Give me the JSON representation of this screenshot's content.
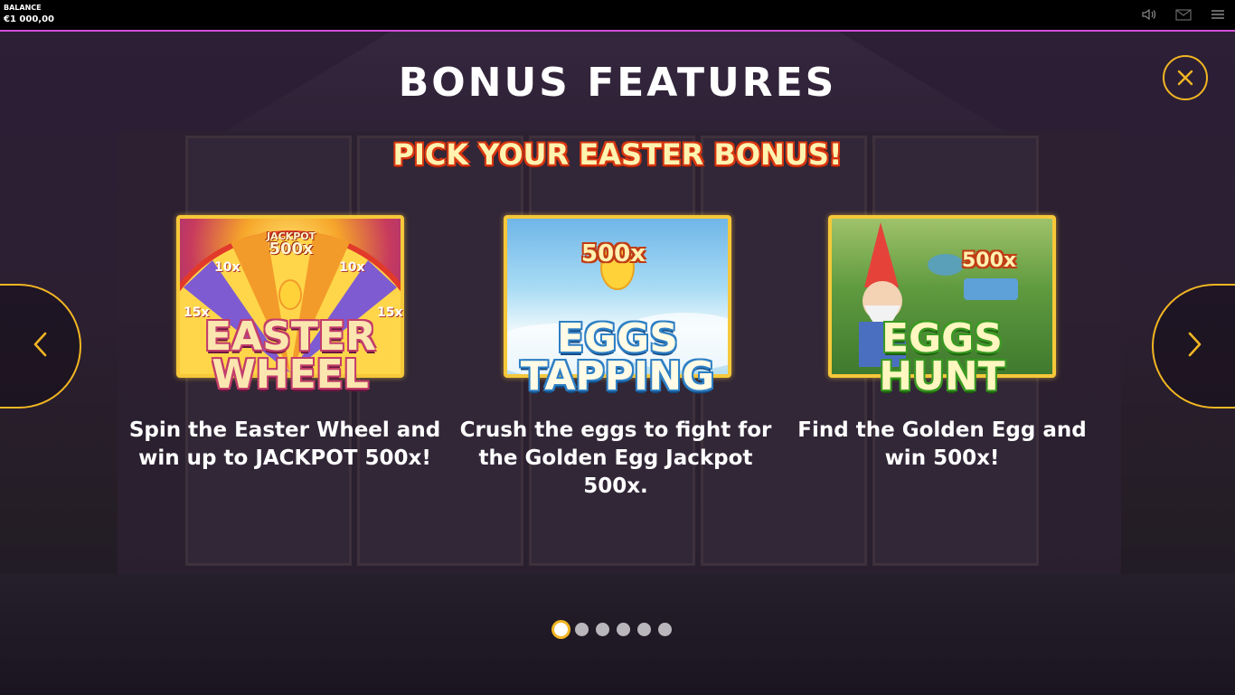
{
  "topbar": {
    "balance_label": "BALANCE",
    "balance_value": "€1 000,00",
    "icons": [
      "sound-icon",
      "mail-icon",
      "menu-icon"
    ]
  },
  "screen": {
    "title": "BONUS FEATURES",
    "subtitle": "PICK YOUR EASTER BONUS!"
  },
  "cards": [
    {
      "title_line1": "EASTER",
      "title_line2": "WHEEL",
      "wheel_labels": [
        "10x",
        "10x",
        "15x",
        "15x"
      ],
      "jackpot_label": "JACKPOT",
      "jackpot_value": "500x",
      "description": "Spin the Easter Wheel and win up to JACKPOT 500x!"
    },
    {
      "title_line1": "EGGS",
      "title_line2": "TAPPING",
      "multiplier": "500x",
      "description": "Crush the eggs to fight for the Golden Egg Jackpot 500x."
    },
    {
      "title_line1": "EGGS",
      "title_line2": "HUNT",
      "multiplier": "500x",
      "description": "Find the Golden Egg and win 500x!"
    }
  ],
  "pagination": {
    "total": 6,
    "active": 1
  },
  "colors": {
    "accent_gold": "#f2b623",
    "topbar_border": "#d24fd6"
  }
}
